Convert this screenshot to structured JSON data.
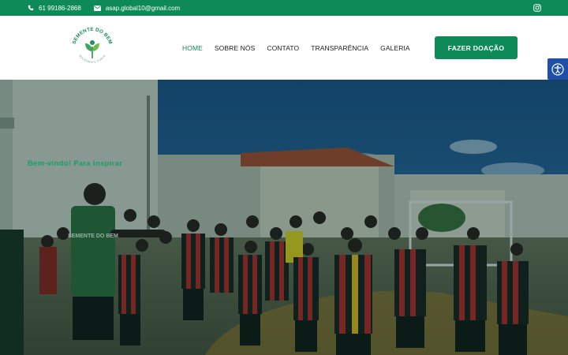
{
  "topbar": {
    "phone": "61 99186-2868",
    "email": "asap.global10@gmail.com",
    "phone_icon": "phone-icon",
    "email_icon": "envelope-icon",
    "social_icon": "instagram-icon"
  },
  "logo": {
    "text_top": "SEMENTE DO BEM",
    "text_bottom": "SOLIDARIA E FORTE"
  },
  "nav": {
    "items": [
      {
        "label": "HOME",
        "active": true
      },
      {
        "label": "SOBRE NÓS",
        "active": false
      },
      {
        "label": "CONTATO",
        "active": false
      },
      {
        "label": "TRANSPARÊNCIA",
        "active": false
      },
      {
        "label": "GALERIA",
        "active": false
      }
    ]
  },
  "cta": {
    "label": "FAZER DOAÇÃO"
  },
  "hero": {
    "tagline": "Bem-vindo! Para Inspirar",
    "jersey_text": "SEMENTE DO BEM"
  },
  "accessibility": {
    "icon": "accessibility-icon"
  },
  "colors": {
    "brand_green": "#0e8a58",
    "accessibility_blue": "#1f4fa6"
  }
}
